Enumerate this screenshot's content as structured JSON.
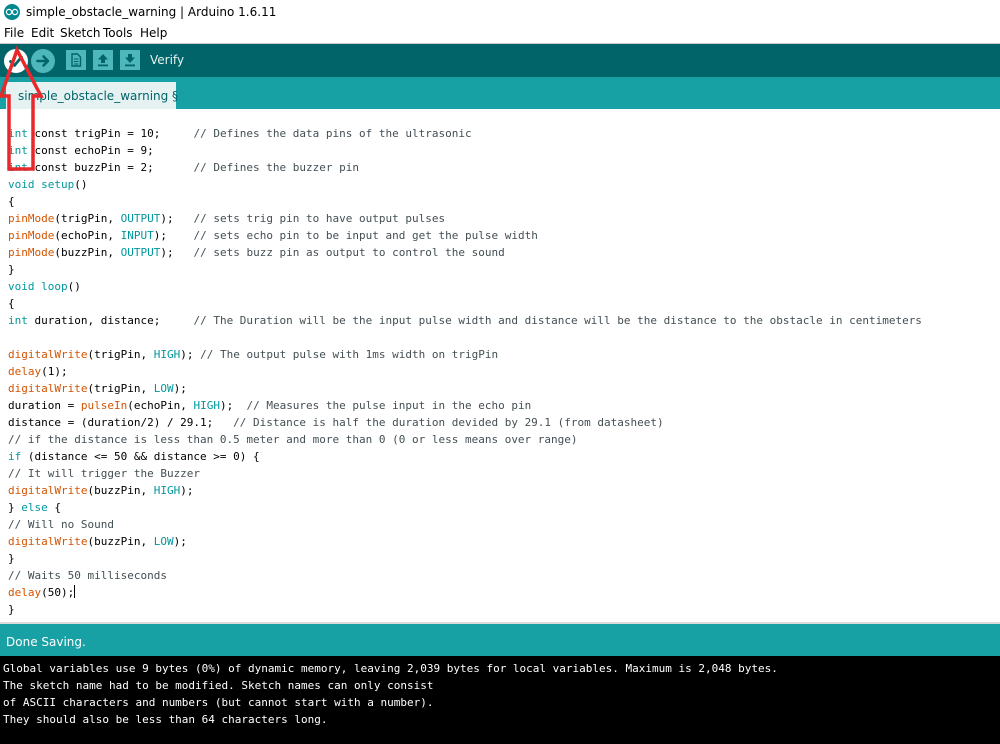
{
  "window": {
    "title": "simple_obstacle_warning | Arduino 1.6.11"
  },
  "menu": [
    "File",
    "Edit",
    "Sketch",
    "Tools",
    "Help"
  ],
  "toolbar": {
    "hover_label": "Verify"
  },
  "tabs": [
    {
      "label": "simple_obstacle_warning §"
    }
  ],
  "code": [
    [
      [
        "int",
        "kw"
      ],
      [
        " const trigPin = 10;     ",
        ""
      ],
      [
        "// Defines the data pins of the ultrasonic",
        "cm"
      ]
    ],
    [
      [
        "int",
        "kw"
      ],
      [
        " const echoPin = 9;",
        ""
      ]
    ],
    [
      [
        "int",
        "kw"
      ],
      [
        " const buzzPin = 2;      ",
        ""
      ],
      [
        "// Defines the buzzer pin",
        "cm"
      ]
    ],
    [
      [
        "void",
        "kw"
      ],
      [
        " ",
        ""
      ],
      [
        "setup",
        "kw"
      ],
      [
        "()",
        ""
      ]
    ],
    [
      [
        "{",
        ""
      ]
    ],
    [
      [
        "pinMode",
        "fn"
      ],
      [
        "(trigPin, ",
        ""
      ],
      [
        "OUTPUT",
        "cn"
      ],
      [
        ");   ",
        ""
      ],
      [
        "// sets trig pin to have output pulses",
        "cm"
      ]
    ],
    [
      [
        "pinMode",
        "fn"
      ],
      [
        "(echoPin, ",
        ""
      ],
      [
        "INPUT",
        "cn"
      ],
      [
        ");    ",
        ""
      ],
      [
        "// sets echo pin to be input and get the pulse width",
        "cm"
      ]
    ],
    [
      [
        "pinMode",
        "fn"
      ],
      [
        "(buzzPin, ",
        ""
      ],
      [
        "OUTPUT",
        "cn"
      ],
      [
        ");   ",
        ""
      ],
      [
        "// sets buzz pin as output to control the sound",
        "cm"
      ]
    ],
    [
      [
        "}",
        ""
      ]
    ],
    [
      [
        "void",
        "kw"
      ],
      [
        " ",
        ""
      ],
      [
        "loop",
        "kw"
      ],
      [
        "()",
        ""
      ]
    ],
    [
      [
        "{",
        ""
      ]
    ],
    [
      [
        "int",
        "kw"
      ],
      [
        " duration, distance;     ",
        ""
      ],
      [
        "// The Duration will be the input pulse width and distance will be the distance to the obstacle in centimeters",
        "cm"
      ]
    ],
    [],
    [
      [
        "digitalWrite",
        "fn"
      ],
      [
        "(trigPin, ",
        ""
      ],
      [
        "HIGH",
        "cn"
      ],
      [
        "); ",
        ""
      ],
      [
        "// The output pulse with 1ms width on trigPin",
        "cm"
      ]
    ],
    [
      [
        "delay",
        "fn"
      ],
      [
        "(1);",
        ""
      ]
    ],
    [
      [
        "digitalWrite",
        "fn"
      ],
      [
        "(trigPin, ",
        ""
      ],
      [
        "LOW",
        "cn"
      ],
      [
        ");",
        ""
      ]
    ],
    [
      [
        "duration = ",
        ""
      ],
      [
        "pulseIn",
        "fn"
      ],
      [
        "(echoPin, ",
        ""
      ],
      [
        "HIGH",
        "cn"
      ],
      [
        ");  ",
        ""
      ],
      [
        "// Measures the pulse input in the echo pin",
        "cm"
      ]
    ],
    [
      [
        "distance = (duration/2) / 29.1;   ",
        ""
      ],
      [
        "// Distance is half the duration devided by 29.1 (from datasheet)",
        "cm"
      ]
    ],
    [
      [
        "// if the distance is less than 0.5 meter and more than 0 (0 or less means over range)",
        "cm"
      ]
    ],
    [
      [
        "if",
        "kw"
      ],
      [
        " (distance <= 50 && distance >= 0) {",
        ""
      ]
    ],
    [
      [
        "// It will trigger the Buzzer",
        "cm"
      ]
    ],
    [
      [
        "digitalWrite",
        "fn"
      ],
      [
        "(buzzPin, ",
        ""
      ],
      [
        "HIGH",
        "cn"
      ],
      [
        ");",
        ""
      ]
    ],
    [
      [
        "} ",
        ""
      ],
      [
        "else",
        "kw"
      ],
      [
        " {",
        ""
      ]
    ],
    [
      [
        "// Will no Sound",
        "cm"
      ]
    ],
    [
      [
        "digitalWrite",
        "fn"
      ],
      [
        "(buzzPin, ",
        ""
      ],
      [
        "LOW",
        "cn"
      ],
      [
        ");",
        ""
      ]
    ],
    [
      [
        "}",
        ""
      ]
    ],
    [
      [
        "// Waits 50 milliseconds",
        "cm"
      ]
    ],
    [
      [
        "delay",
        "fn"
      ],
      [
        "(50);",
        ""
      ]
    ],
    [
      [
        "}",
        ""
      ]
    ]
  ],
  "status": {
    "text": "Done Saving."
  },
  "console": [
    "Global variables use 9 bytes (0%) of dynamic memory, leaving 2,039 bytes for local variables. Maximum is 2,048 bytes.",
    "The sketch name had to be modified. Sketch names can only consist",
    "of ASCII characters and numbers (but cannot start with a number).",
    "They should also be less than 64 characters long."
  ],
  "colors": {
    "toolbar_bg": "#006468",
    "tab_bar_bg": "#17A1A5",
    "tab_bg": "#E6F2F2",
    "keyword": "#00979C",
    "function": "#D35400",
    "comment": "#434F54",
    "annotation_arrow": "#E8282B"
  },
  "icons": {
    "verify": "check-icon",
    "upload": "arrow-right-icon",
    "new": "new-file-icon",
    "open": "open-arrow-up-icon",
    "save": "save-arrow-down-icon"
  }
}
